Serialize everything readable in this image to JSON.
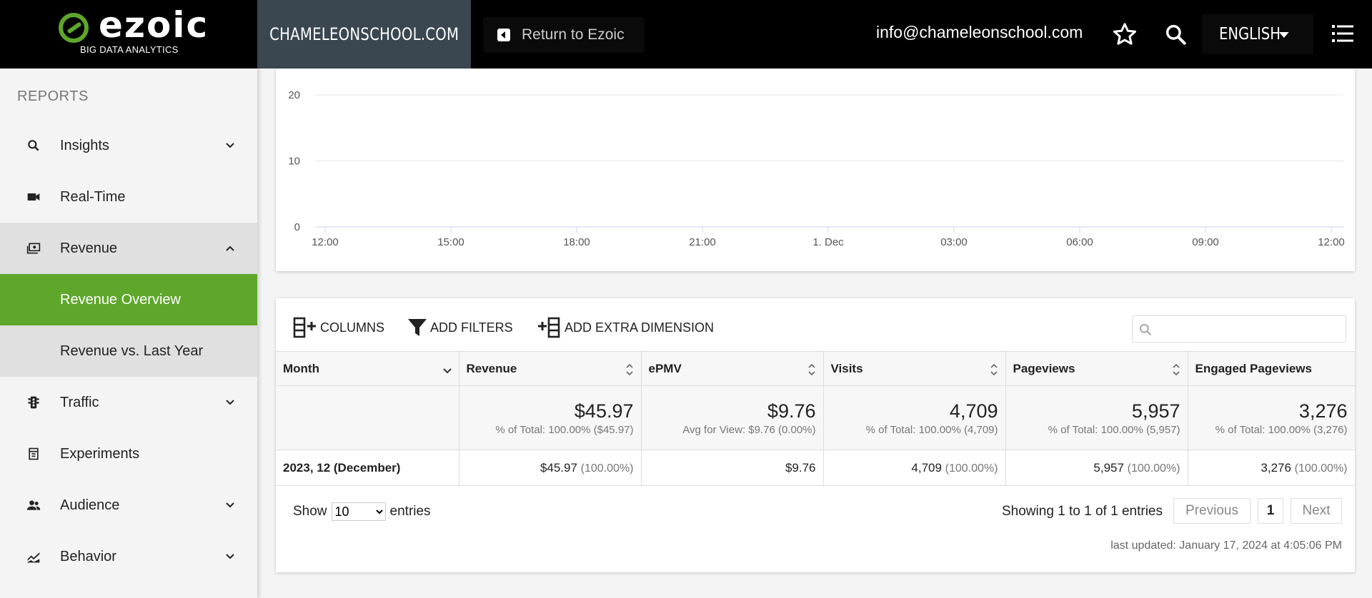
{
  "header": {
    "logo_word": "ezoic",
    "logo_sub": "BIG DATA ANALYTICS",
    "site": "CHAMELEONSCHOOL.COM",
    "return_label": "Return to Ezoic",
    "email": "info@chameleonschool.com",
    "language": "ENGLISH",
    "icons": [
      "star-icon",
      "search-icon",
      "menu-icon"
    ]
  },
  "sidebar": {
    "title": "REPORTS",
    "items": [
      {
        "label": "Insights",
        "icon": "search-icon",
        "expandable": true,
        "expanded": false
      },
      {
        "label": "Real-Time",
        "icon": "video-camera-icon",
        "expandable": false
      },
      {
        "label": "Revenue",
        "icon": "money-icon",
        "expandable": true,
        "expanded": true
      },
      {
        "label": "Revenue Overview",
        "sub": true,
        "active": true
      },
      {
        "label": "Revenue vs. Last Year",
        "sub": true
      },
      {
        "label": "Traffic",
        "icon": "traffic-light-icon",
        "expandable": true,
        "expanded": false
      },
      {
        "label": "Experiments",
        "icon": "experiment-icon",
        "expandable": false
      },
      {
        "label": "Audience",
        "icon": "people-icon",
        "expandable": true,
        "expanded": false
      },
      {
        "label": "Behavior",
        "icon": "trend-icon",
        "expandable": true,
        "expanded": false
      }
    ],
    "active_color": "#5ea72a"
  },
  "chart_data": {
    "type": "line",
    "y_ticks": [
      "0",
      "10",
      "20"
    ],
    "x_ticks": [
      "12:00",
      "15:00",
      "18:00",
      "21:00",
      "1. Dec",
      "03:00",
      "06:00",
      "09:00",
      "12:00"
    ],
    "ylim": [
      0,
      20
    ],
    "grid": true
  },
  "table": {
    "toolbar": {
      "columns": "COLUMNS",
      "filters": "ADD FILTERS",
      "dimension": "ADD EXTRA DIMENSION",
      "search_placeholder": ""
    },
    "columns": [
      "Month",
      "Revenue",
      "ePMV",
      "Visits",
      "Pageviews",
      "Engaged Pageviews"
    ],
    "totals": [
      {
        "value": "$45.97",
        "note": "% of Total: 100.00% ($45.97)"
      },
      {
        "value": "$9.76",
        "note": "Avg for View: $9.76 (0.00%)"
      },
      {
        "value": "4,709",
        "note": "% of Total: 100.00% (4,709)"
      },
      {
        "value": "5,957",
        "note": "% of Total: 100.00% (5,957)"
      },
      {
        "value": "3,276",
        "note": "% of Total: 100.00% (3,276)"
      }
    ],
    "rows": [
      {
        "month": "2023, 12 (December)",
        "cells": [
          {
            "value": "$45.97",
            "pct": "(100.00%)"
          },
          {
            "value": "$9.76",
            "pct": ""
          },
          {
            "value": "4,709",
            "pct": "(100.00%)"
          },
          {
            "value": "5,957",
            "pct": "(100.00%)"
          },
          {
            "value": "3,276",
            "pct": "(100.00%)"
          }
        ]
      }
    ],
    "show_label": "Show",
    "entries_value": "10",
    "entries_label": "entries",
    "showing": "Showing 1 to 1 of 1 entries",
    "prev": "Previous",
    "page": "1",
    "next": "Next",
    "last_updated": "last updated: January 17, 2024 at 4:05:06 PM"
  }
}
